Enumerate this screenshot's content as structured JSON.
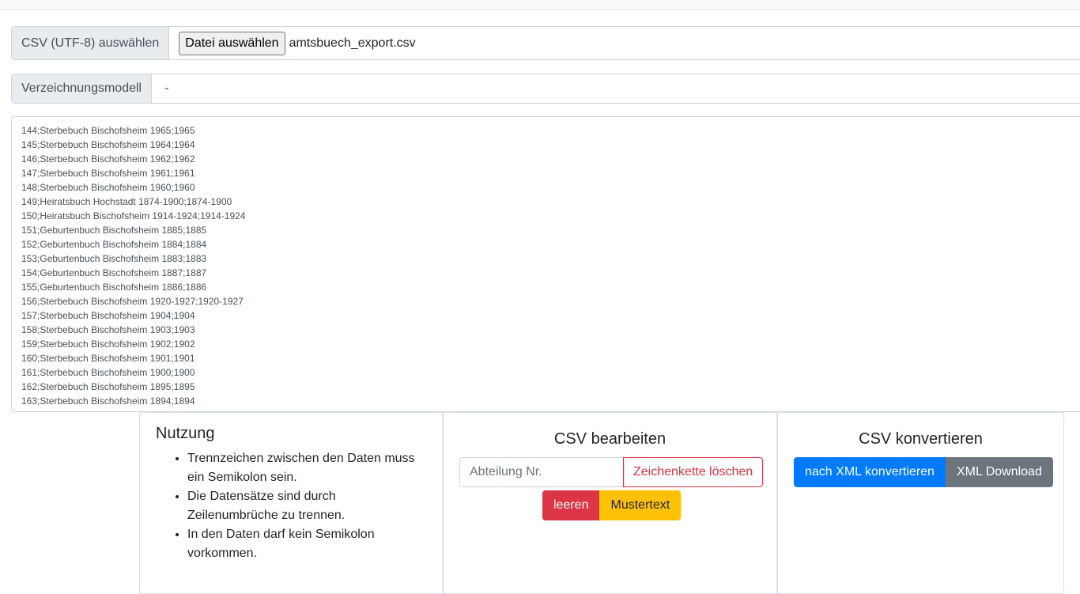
{
  "upload": {
    "label": "CSV (UTF-8) auswählen",
    "button": "Datei auswählen",
    "filename": "amtsbuech_export.csv"
  },
  "model": {
    "label": "Verzeichnungsmodell",
    "value": "-"
  },
  "csv_lines": [
    "144;Sterbebuch Bischofsheim 1965;1965",
    "145;Sterbebuch Bischofsheim 1964;1964",
    "146;Sterbebuch Bischofsheim 1962;1962",
    "147;Sterbebuch Bischofsheim 1961;1961",
    "148;Sterbebuch Bischofsheim 1960;1960",
    "149;Heiratsbuch Hochstadt 1874-1900;1874-1900",
    "150;Heiratsbuch Bischofsheim 1914-1924;1914-1924",
    "151;Geburtenbuch Bischofsheim 1885;1885",
    "152;Geburtenbuch Bischofsheim 1884;1884",
    "153;Geburtenbuch Bischofsheim 1883;1883",
    "154;Geburtenbuch Bischofsheim 1887;1887",
    "155;Geburtenbuch Bischofsheim 1886;1886",
    "156;Sterbebuch Bischofsheim 1920-1927;1920-1927",
    "157;Sterbebuch Bischofsheim 1904;1904",
    "158;Sterbebuch Bischofsheim 1903;1903",
    "159;Sterbebuch Bischofsheim 1902;1902",
    "160;Sterbebuch Bischofsheim 1901;1901",
    "161;Sterbebuch Bischofsheim 1900;1900",
    "162;Sterbebuch Bischofsheim 1895;1895",
    "163;Sterbebuch Bischofsheim 1894;1894"
  ],
  "usage": {
    "title": "Nutzung",
    "items": [
      "Trennzeichen zwischen den Daten muss ein Semikolon sein.",
      "Die Datensätze sind durch Zeilenumbrüche zu trennen.",
      "In den Daten darf kein Semikolon vorkommen."
    ]
  },
  "edit": {
    "title": "CSV bearbeiten",
    "input_placeholder": "Abteilung Nr.",
    "clear_string_button": "Zeichenkette löschen",
    "empty_button": "leeren",
    "sample_button": "Mustertext"
  },
  "convert": {
    "title": "CSV konvertieren",
    "to_xml_button": "nach XML konvertieren",
    "download_button": "XML Download"
  },
  "colors": {
    "primary": "#007bff",
    "secondary": "#6c757d",
    "danger": "#dc3545",
    "warning": "#ffc107"
  }
}
